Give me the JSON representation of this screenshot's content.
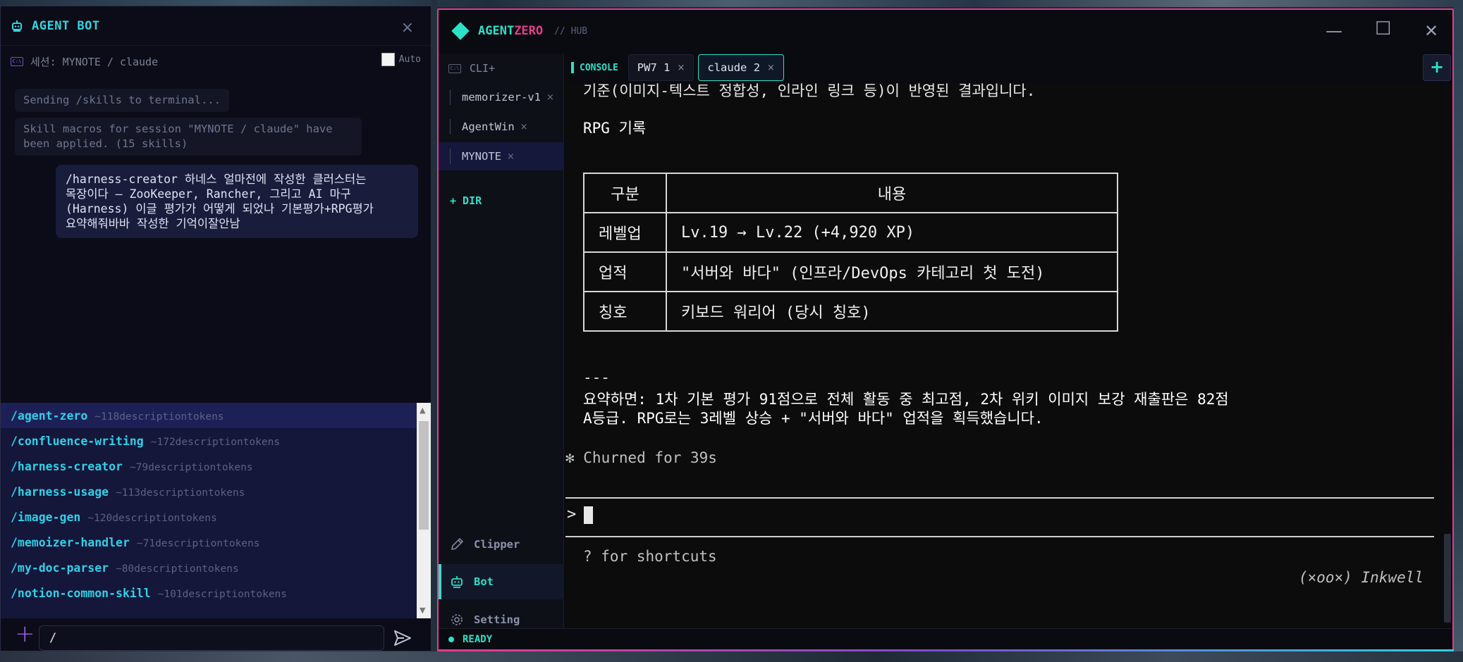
{
  "agent_bot": {
    "title": "AGENT BOT",
    "close": "×",
    "session_label": "세션: MYNOTE / claude",
    "session_icon": "terminal-icon",
    "auto_label": "Auto",
    "auto_checked": false,
    "messages": {
      "sys1": "Sending /skills to terminal...",
      "sys2_line1": "Skill macros for session \"MYNOTE / claude\" have",
      "sys2_line2": "been applied. (15 skills)",
      "user_line1": "/harness-creator 하네스 얼마전에 작성한 클러스터는",
      "user_line2": "목장이다 — ZooKeeper, Rancher, 그리고 AI 마구",
      "user_line3": "(Harness) 이글 평가가 어떻게 되었나 기본평가+RPG평가",
      "user_line4": "요약해줘바바 작성한 기억이잘안남"
    },
    "skills": [
      {
        "name": "/agent-zero",
        "tokens": "~118descriptiontokens"
      },
      {
        "name": "/confluence-writing",
        "tokens": "~172descriptiontokens"
      },
      {
        "name": "/harness-creator",
        "tokens": "~79descriptiontokens"
      },
      {
        "name": "/harness-usage",
        "tokens": "~113descriptiontokens"
      },
      {
        "name": "/image-gen",
        "tokens": "~120descriptiontokens"
      },
      {
        "name": "/memoizer-handler",
        "tokens": "~71descriptiontokens"
      },
      {
        "name": "/my-doc-parser",
        "tokens": "~80descriptiontokens"
      },
      {
        "name": "/notion-common-skill",
        "tokens": "~101descriptiontokens"
      }
    ],
    "input_value": "/",
    "colors": {
      "accent": "#35d3e0",
      "purple": "#9a5cf0",
      "selected_row": "#1d2057"
    }
  },
  "agent_zero": {
    "brand_a": "AGENT",
    "brand_b": "ZERO",
    "hub": "// HUB",
    "window_buttons": {
      "min": "—",
      "max": "☐",
      "close": "✕"
    },
    "sidebar": {
      "cli_label": "CLI+",
      "sessions": [
        {
          "label": "memorizer-v1",
          "close": "×"
        },
        {
          "label": "AgentWin",
          "close": "×"
        },
        {
          "label": "MYNOTE",
          "close": "×"
        }
      ],
      "add_dir": "+ DIR",
      "nav": {
        "clipper": "Clipper",
        "bot": "Bot",
        "setting": "Setting"
      }
    },
    "tabs": {
      "console": "CONSOLE",
      "items": [
        {
          "label": "PW7 1",
          "close": "×"
        },
        {
          "label": "claude 2",
          "close": "×"
        }
      ],
      "new": "+"
    },
    "terminal": {
      "line_top": "기준(이미지-텍스트 정합성, 인라인 링크 등)이 반영된 결과입니다.",
      "heading": "RPG 기록",
      "table": {
        "headers": [
          "구분",
          "내용"
        ],
        "rows": [
          [
            "레벨업",
            "Lv.19 → Lv.22 (+4,920 XP)"
          ],
          [
            "업적",
            "\"서버와 바다\" (인프라/DevOps 카테고리 첫 도전)"
          ],
          [
            "칭호",
            "키보드 워리어 (당시 칭호)"
          ]
        ]
      },
      "rule": "---",
      "summary1": "요약하면: 1차 기본 평가 91점으로 전체 활동 중 최고점, 2차 위키 이미지 보강 재출판은 82점",
      "summary2": "A등급. RPG로는 3레벨 상승 + \"서버와 바다\" 업적을 획득했습니다.",
      "churned": "✻ Churned for 39s",
      "prompt": ">",
      "shortcuts": "? for shortcuts",
      "signature": "(×oo×) Inkwell"
    },
    "status": "READY",
    "colors": {
      "teal": "#2de0c8",
      "pink": "#e53b8c"
    }
  }
}
